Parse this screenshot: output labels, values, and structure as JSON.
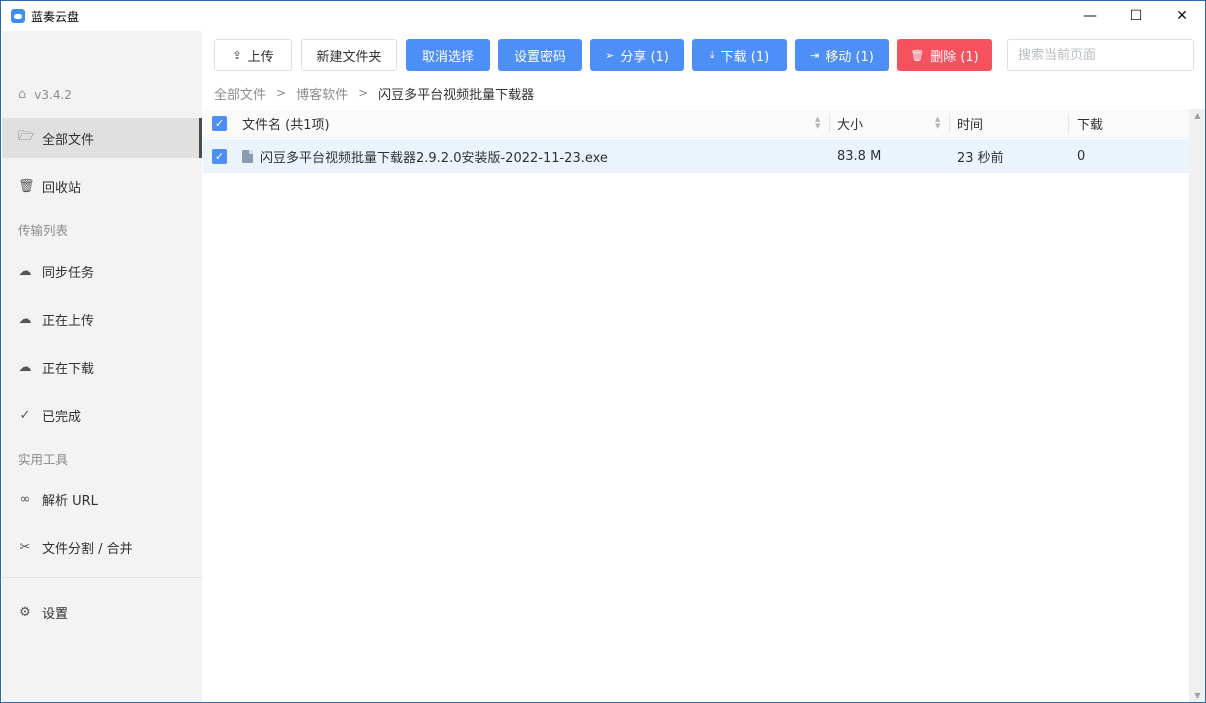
{
  "window": {
    "title": "蓝奏云盘",
    "controls": {
      "minimize": "—",
      "maximize": "☐",
      "close": "✕"
    }
  },
  "sidebar": {
    "version": "v3.4.2",
    "items": [
      {
        "label": "全部文件",
        "icon": "folder-open-icon",
        "glyph": "🗁"
      },
      {
        "label": "回收站",
        "icon": "trash-icon",
        "glyph": "🗑"
      },
      {
        "label": "同步任务",
        "icon": "cloud-sync-icon",
        "glyph": "☁"
      },
      {
        "label": "正在上传",
        "icon": "cloud-upload-icon",
        "glyph": "☁"
      },
      {
        "label": "正在下载",
        "icon": "cloud-download-icon",
        "glyph": "☁"
      },
      {
        "label": "已完成",
        "icon": "check-circle-icon",
        "glyph": "✓"
      },
      {
        "label": "解析 URL",
        "icon": "link-icon",
        "glyph": "∞"
      },
      {
        "label": "文件分割 / 合并",
        "icon": "scissors-icon",
        "glyph": "✂"
      },
      {
        "label": "设置",
        "icon": "gear-icon",
        "glyph": "⚙"
      }
    ],
    "groups": {
      "transfer": "传输列表",
      "tools": "实用工具"
    }
  },
  "toolbar": {
    "upload": "上传",
    "new_folder": "新建文件夹",
    "cancel_select": "取消选择",
    "set_password": "设置密码",
    "share": "分享 (1)",
    "download": "下载 (1)",
    "move": "移动 (1)",
    "delete": "删除 (1)",
    "search_placeholder": "搜索当前页面"
  },
  "breadcrumb": [
    "全部文件",
    "博客软件",
    "闪豆多平台视频批量下载器"
  ],
  "table": {
    "headers": {
      "name": "文件名 (共1项)",
      "size": "大小",
      "time": "时间",
      "downloads": "下载"
    },
    "rows": [
      {
        "name": "闪豆多平台视频批量下载器2.9.2.0安装版-2022-11-23.exe",
        "size": "83.8 M",
        "time": "23 秒前",
        "downloads": "0",
        "checked": true
      }
    ]
  },
  "colors": {
    "accent": "#4d8ef7",
    "danger": "#f5515f",
    "selected_row": "#ebf3fd"
  }
}
